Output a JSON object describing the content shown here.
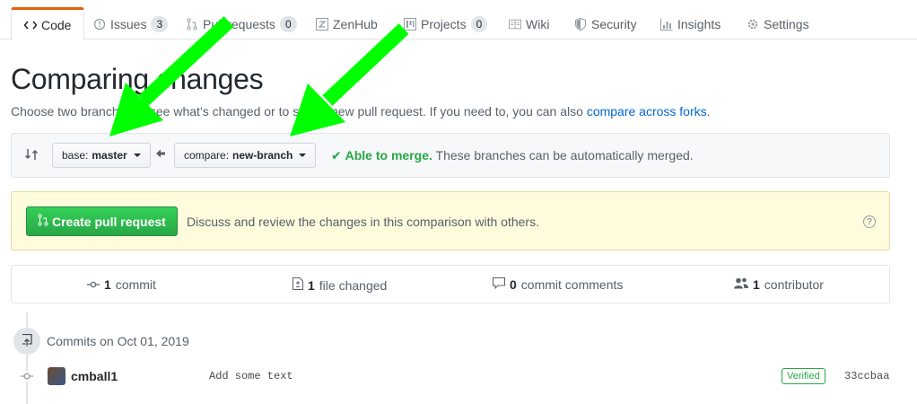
{
  "tabs": [
    {
      "label": "Code",
      "icon": "code-icon"
    },
    {
      "label": "Issues",
      "count": "3",
      "icon": "issue-icon"
    },
    {
      "label": "Pull requests",
      "count": "0",
      "icon": "pull-request-icon"
    },
    {
      "label": "ZenHub",
      "icon": "zenhub-icon"
    },
    {
      "label": "Projects",
      "count": "0",
      "icon": "project-icon"
    },
    {
      "label": "Wiki",
      "icon": "book-icon"
    },
    {
      "label": "Security",
      "icon": "shield-icon"
    },
    {
      "label": "Insights",
      "icon": "graph-icon"
    },
    {
      "label": "Settings",
      "icon": "gear-icon"
    }
  ],
  "header": {
    "title": "Comparing changes",
    "subtitle_prefix": "Choose two branches to see what’s changed or to start a new pull request. If you need to, you can also ",
    "subtitle_link": "compare across forks",
    "subtitle_suffix": "."
  },
  "range": {
    "base_prefix": "base:",
    "base_branch": "master",
    "compare_prefix": "compare:",
    "compare_branch": "new-branch",
    "merge_ok": "Able to merge.",
    "merge_text": "These branches can be automatically merged."
  },
  "flash": {
    "button": "Create pull request",
    "text": "Discuss and review the changes in this comparison with others.",
    "help": "?"
  },
  "numbers": {
    "commits_count": "1",
    "commits_label": "commit",
    "files_count": "1",
    "files_label": "file changed",
    "comments_count": "0",
    "comments_label": "commit comments",
    "contributors_count": "1",
    "contributors_label": "contributor"
  },
  "timeline": {
    "date_label": "Commits on Oct 01, 2019",
    "commit": {
      "author": "cmball1",
      "message": "Add some text",
      "badge": "Verified",
      "sha": "33ccbaa"
    }
  },
  "colors": {
    "tab_accent": "#e36209",
    "link": "#0366d6",
    "success": "#28a745",
    "annotation_arrow": "#00ff00"
  }
}
